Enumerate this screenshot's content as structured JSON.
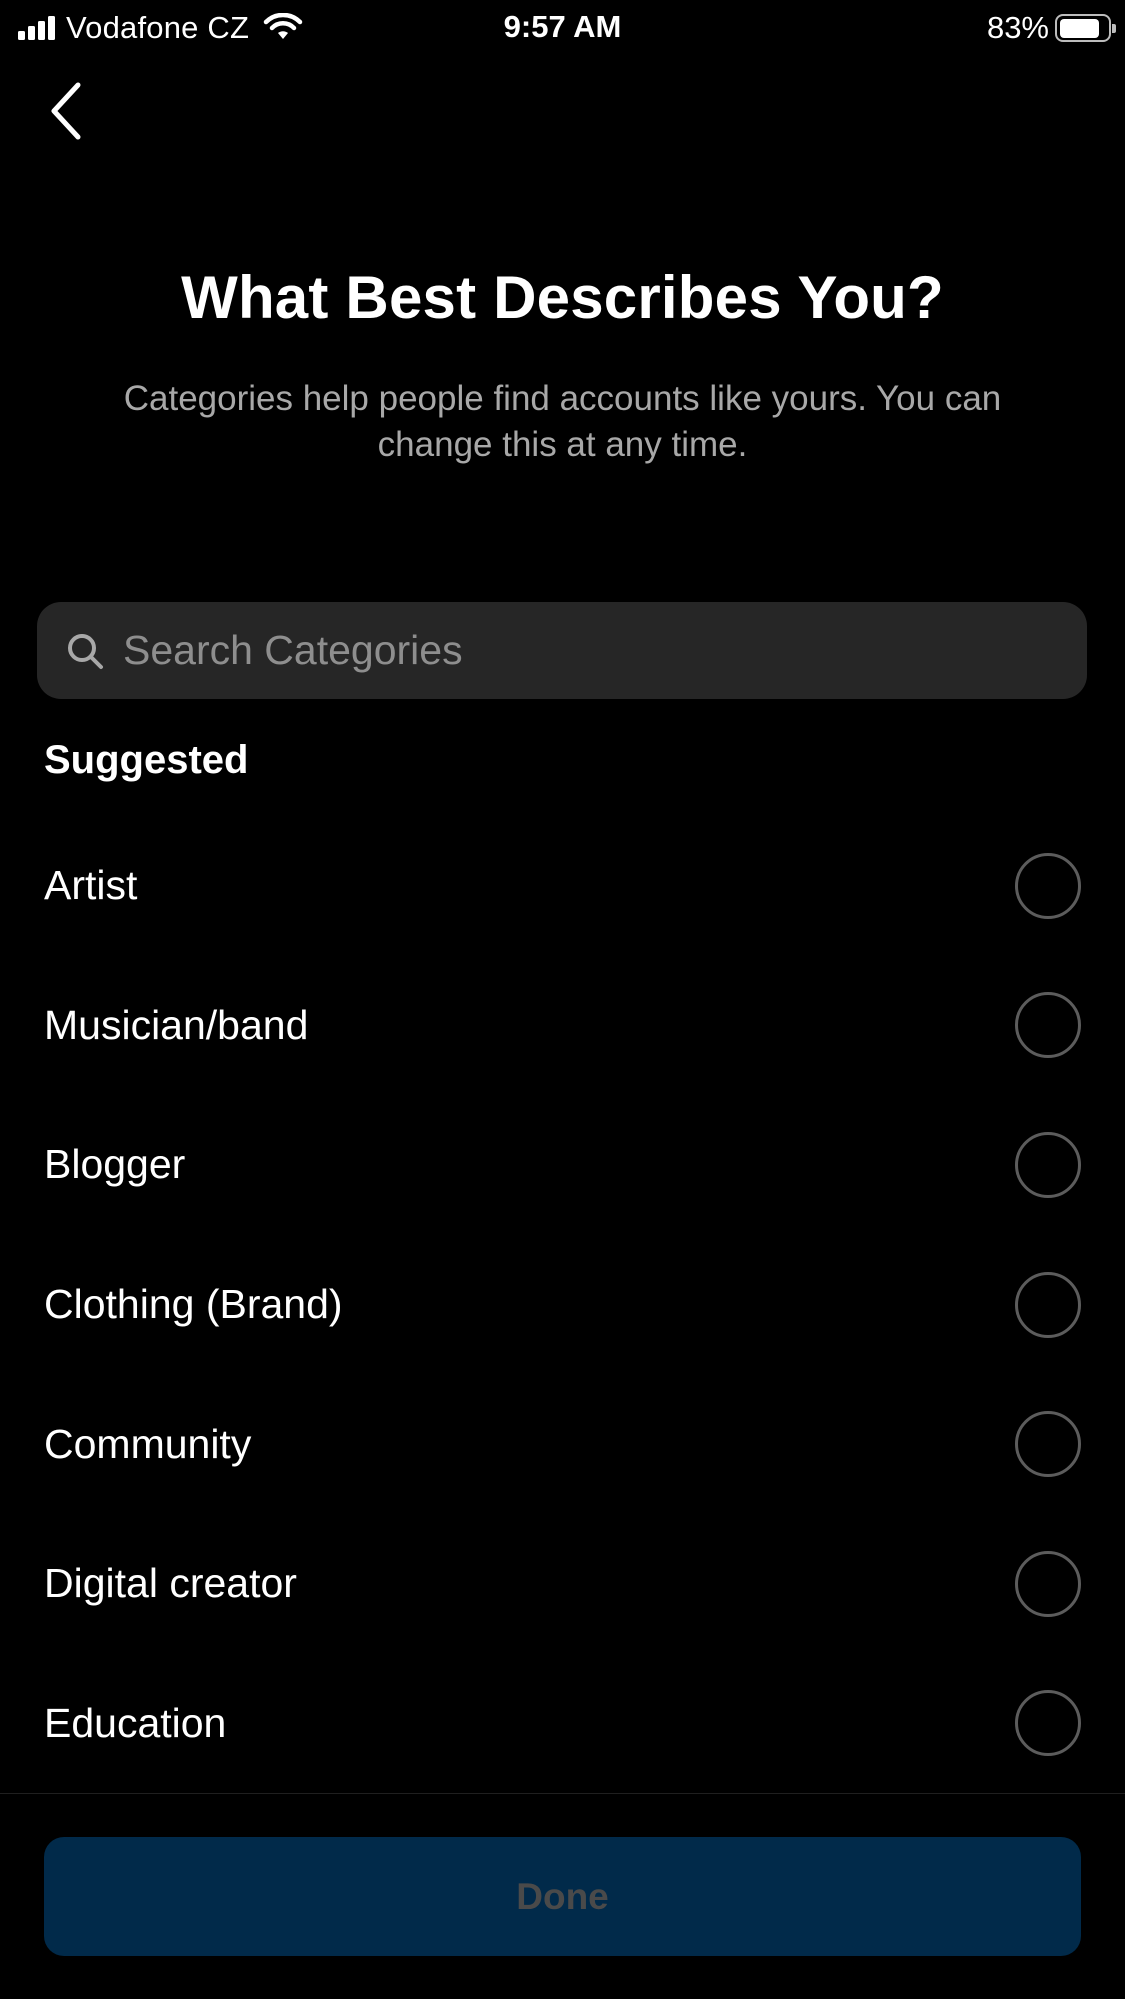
{
  "status_bar": {
    "carrier": "Vodafone CZ",
    "time": "9:57 AM",
    "battery_percent": "83%",
    "battery_level": 0.83,
    "signal_bars": 4,
    "icons": [
      "signal-icon",
      "wifi-icon",
      "battery-icon"
    ]
  },
  "nav": {
    "back_icon": "chevron-left-icon"
  },
  "header": {
    "title": "What Best Describes You?",
    "subtitle": "Categories help people find accounts like yours. You can change this at any time."
  },
  "search": {
    "placeholder": "Search Categories",
    "value": "",
    "icon": "search-icon"
  },
  "suggested": {
    "section_title": "Suggested",
    "items": [
      {
        "label": "Artist",
        "selected": false
      },
      {
        "label": "Musician/band",
        "selected": false
      },
      {
        "label": "Blogger",
        "selected": false
      },
      {
        "label": "Clothing (Brand)",
        "selected": false
      },
      {
        "label": "Community",
        "selected": false
      },
      {
        "label": "Digital creator",
        "selected": false
      },
      {
        "label": "Education",
        "selected": false
      }
    ]
  },
  "footer": {
    "done_label": "Done",
    "done_enabled": false
  },
  "colors": {
    "background": "#000000",
    "search_background": "#262626",
    "subtitle_text": "#a8a8a8",
    "placeholder_text": "#8e8e8e",
    "radio_border": "#5c5c5c",
    "done_button_background": "#012a4a",
    "done_button_text": "#4a4a4a"
  }
}
